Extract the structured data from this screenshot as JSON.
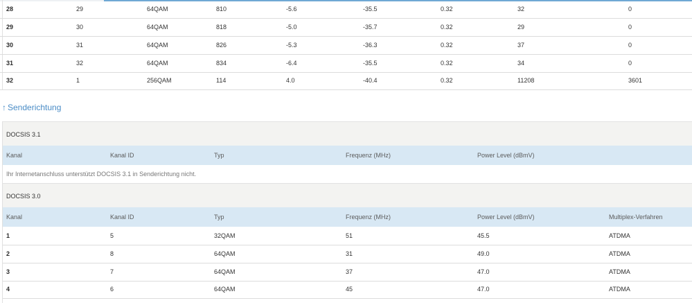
{
  "downstream": {
    "rows": [
      [
        "28",
        "29",
        "64QAM",
        "810",
        "-5.6",
        "-35.5",
        "0.32",
        "32",
        "0"
      ],
      [
        "29",
        "30",
        "64QAM",
        "818",
        "-5.0",
        "-35.7",
        "0.32",
        "29",
        "0"
      ],
      [
        "30",
        "31",
        "64QAM",
        "826",
        "-5.3",
        "-36.3",
        "0.32",
        "37",
        "0"
      ],
      [
        "31",
        "32",
        "64QAM",
        "834",
        "-6.4",
        "-35.5",
        "0.32",
        "34",
        "0"
      ],
      [
        "32",
        "1",
        "256QAM",
        "114",
        "4.0",
        "-40.4",
        "0.32",
        "11208",
        "3601"
      ]
    ]
  },
  "upstream": {
    "anchor_arrow": "↑",
    "anchor_label": "Senderichtung",
    "docsis31": {
      "title": "DOCSIS 3.1",
      "headers": [
        "Kanal",
        "Kanal ID",
        "Typ",
        "Frequenz (MHz)",
        "Power Level (dBmV)"
      ],
      "message": "Ihr Internetanschluss unterstützt DOCSIS 3.1 in Senderichtung nicht."
    },
    "docsis30": {
      "title": "DOCSIS 3.0",
      "headers": [
        "Kanal",
        "Kanal ID",
        "Typ",
        "Frequenz (MHz)",
        "Power Level (dBmV)",
        "Multiplex-Verfahren"
      ],
      "rows": [
        [
          "1",
          "5",
          "32QAM",
          "51",
          "45.5",
          "ATDMA"
        ],
        [
          "2",
          "8",
          "64QAM",
          "31",
          "49.0",
          "ATDMA"
        ],
        [
          "3",
          "7",
          "64QAM",
          "37",
          "47.0",
          "ATDMA"
        ],
        [
          "4",
          "6",
          "64QAM",
          "45",
          "47.0",
          "ATDMA"
        ]
      ]
    }
  }
}
